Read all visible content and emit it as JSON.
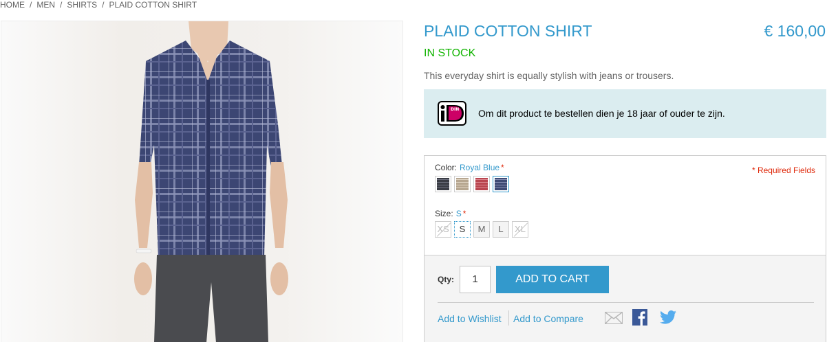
{
  "breadcrumb": {
    "items": [
      "HOME",
      "MEN",
      "SHIRTS",
      "PLAID COTTON SHIRT"
    ],
    "separator": "/"
  },
  "product": {
    "name": "PLAID COTTON SHIRT",
    "price": "€ 160,00",
    "stock": "IN STOCK",
    "short_description": "This everyday shirt is equally stylish with jeans or trousers."
  },
  "notice": {
    "logo": "ideal-logo",
    "text": "Om dit product te bestellen dien je 18 jaar of ouder te zijn."
  },
  "options": {
    "required_fields": "* Required Fields",
    "color": {
      "label": "Color:",
      "selected": "Royal Blue",
      "required_mark": "*",
      "swatches": [
        {
          "name": "charcoal",
          "color": "#3a3c44",
          "selected": false
        },
        {
          "name": "khaki",
          "color": "#b6a690",
          "selected": false
        },
        {
          "name": "red",
          "color": "#b9454f",
          "selected": false
        },
        {
          "name": "royal-blue",
          "color": "#3f4a74",
          "selected": true
        }
      ]
    },
    "size": {
      "label": "Size:",
      "selected": "S",
      "required_mark": "*",
      "items": [
        {
          "label": "XS",
          "disabled": true,
          "selected": false
        },
        {
          "label": "S",
          "disabled": false,
          "selected": true
        },
        {
          "label": "M",
          "disabled": false,
          "selected": false
        },
        {
          "label": "L",
          "disabled": false,
          "selected": false
        },
        {
          "label": "XL",
          "disabled": true,
          "selected": false
        }
      ]
    }
  },
  "cart": {
    "qty_label": "Qty:",
    "qty_value": "1",
    "add_to_cart": "ADD TO CART"
  },
  "links": {
    "wishlist": "Add to Wishlist",
    "compare": "Add to Compare"
  },
  "share": {
    "icons": [
      "email-icon",
      "facebook-icon",
      "twitter-icon"
    ],
    "colors": {
      "email": "#b8b8b8",
      "facebook": "#3b5998",
      "twitter": "#55acee"
    }
  },
  "theme": {
    "accent": "#3399cc",
    "stock": "#11b400",
    "required": "#df280a",
    "notice_bg": "#dbedf0"
  }
}
